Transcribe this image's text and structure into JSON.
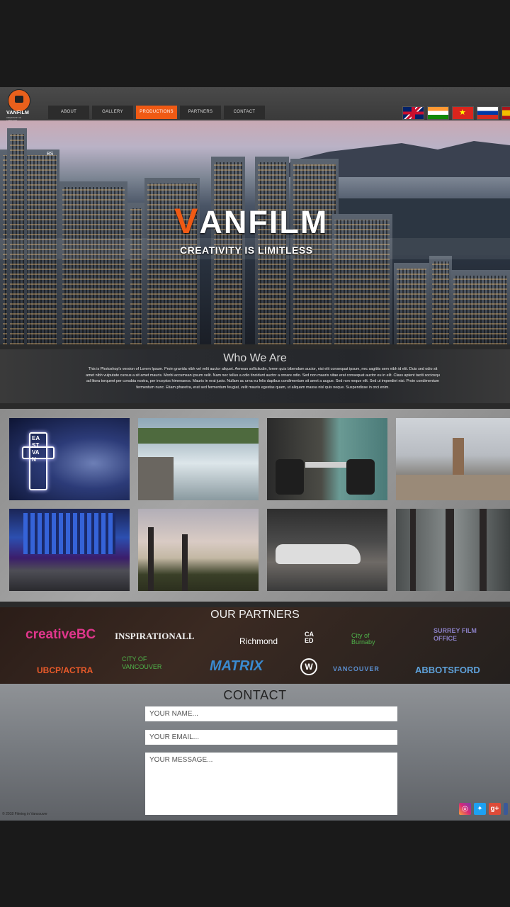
{
  "nav": {
    "logo_text": "VANFILM",
    "logo_tagline": "CREATIVITY IS LIMITLESS",
    "items": [
      "ABOUT",
      "GALLERY",
      "PRODUCTIONS",
      "PARTNERS",
      "CONTACT"
    ],
    "active_index": 2,
    "flags": [
      "uk-flag-icon",
      "india-flag-icon",
      "vietnam-flag-icon",
      "russia-flag-icon",
      "spain-flag-icon"
    ]
  },
  "hero": {
    "title_first": "V",
    "title_rest": "ANFILM",
    "subtitle": "CREATIVITY IS LIMITLESS",
    "sign": "BS"
  },
  "who": {
    "title": "Who We Are",
    "text": "This is Photoshop's version of Lorem Ipsum. Proin gravida nibh vel velit auctor aliquet. Aenean sollicitudin, lorem quis bibendum auctor, nisi elit consequat ipsum, nec sagittis sem nibh id elit. Duis sed odio sit amet nibh vulputate cursus a sit amet mauris. Morbi accumsan ipsum velit. Nam nec tellus a odio tincidunt auctor a ornare odio. Sed non mauris vitae erat consequat auctor eu in elit. Class aptent taciti sociosqu ad litora torquent per conubia nostra, per inceptos himenaeos. Mauris in erat justo. Nullam ac urna eu felis dapibus condimentum sit amet a augue. Sed non neque elit. Sed ut imperdiet nisi. Proin condimentum fermentum nunc. Etiam pharetra, erat sed fermentum feugiat, velit mauris egestas quam, ut aliquam massa nisl quis neque. Suspendisse in orci enim."
  },
  "gallery": {
    "sign_text": "EAST VAN"
  },
  "partners": {
    "title": "OUR PARTNERS",
    "logos": [
      {
        "text": "creativeBC",
        "color": "#e0368c"
      },
      {
        "text": "INSPIRATIONALL",
        "color": "#eeeeee"
      },
      {
        "text": "Richmond",
        "color": "#ffffff"
      },
      {
        "text": "CAED",
        "color": "#ffffff"
      },
      {
        "text": "City of Burnaby",
        "color": "#4fb24a"
      },
      {
        "text": "SURREY FILM OFFICE",
        "color": "#8a7fc4"
      },
      {
        "text": "UBCP/ACTRA",
        "color": "#e85a2a"
      },
      {
        "text": "CITY OF VANCOUVER",
        "color": "#4fb24a"
      },
      {
        "text": "MATRIX",
        "color": "#3a8ad0"
      },
      {
        "text": "W",
        "color": "#ffffff"
      },
      {
        "text": "VANCOUVER",
        "color": "#5b8fd0"
      },
      {
        "text": "ABBOTSFORD",
        "color": "#5ea0d8"
      }
    ]
  },
  "contact": {
    "title": "CONTACT",
    "name_placeholder": "YOUR NAME...",
    "email_placeholder": "YOUR EMAIL...",
    "message_placeholder": "YOUR MESSAGE...",
    "copyright": "© 2018 Filming in Vancouver"
  },
  "colors": {
    "accent": "#f05a14"
  }
}
